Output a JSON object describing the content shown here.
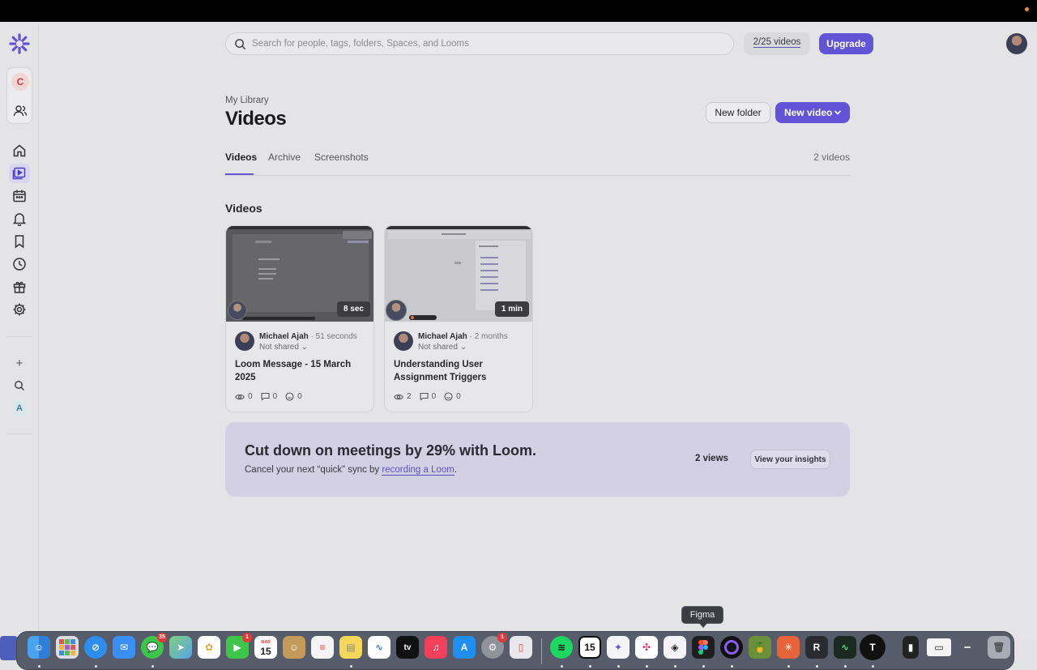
{
  "search": {
    "placeholder": "Search for people, tags, folders, Spaces, and Looms"
  },
  "header": {
    "quota": "2/25 videos",
    "upgrade": "Upgrade"
  },
  "workspace": {
    "initial": "C"
  },
  "sidebar": {
    "small_workspace": "A"
  },
  "page": {
    "breadcrumb": "My Library",
    "title": "Videos",
    "new_folder": "New folder",
    "new_video": "New video",
    "tabs": [
      "Videos",
      "Archive",
      "Screenshots"
    ],
    "count": "2 videos",
    "section_title": "Videos"
  },
  "videos": [
    {
      "duration": "8 sec",
      "author": "Michael Ajah",
      "time": "51 seconds",
      "sharing": "Not shared",
      "title": "Loom Message - 15 March 2025",
      "views": "0",
      "comments": "0",
      "reactions": "0"
    },
    {
      "duration": "1 min",
      "author": "Michael Ajah",
      "time": "2 months",
      "sharing": "Not shared",
      "title": "Understanding User Assignment Triggers",
      "views": "2",
      "comments": "0",
      "reactions": "0"
    }
  ],
  "banner": {
    "heading": "Cut down on meetings by 29% with Loom.",
    "text_before": "Cancel your next “quick” sync by ",
    "link": "recording a Loom",
    "text_after": ".",
    "views": "2 views",
    "button": "View your insights"
  },
  "dock": {
    "tooltip": "Figma",
    "messages_badge": "35",
    "facetime_badge": "1",
    "settings_badge": "1",
    "calendar_month": "MAR",
    "calendar_day": "15",
    "fantastical_day": "15"
  }
}
